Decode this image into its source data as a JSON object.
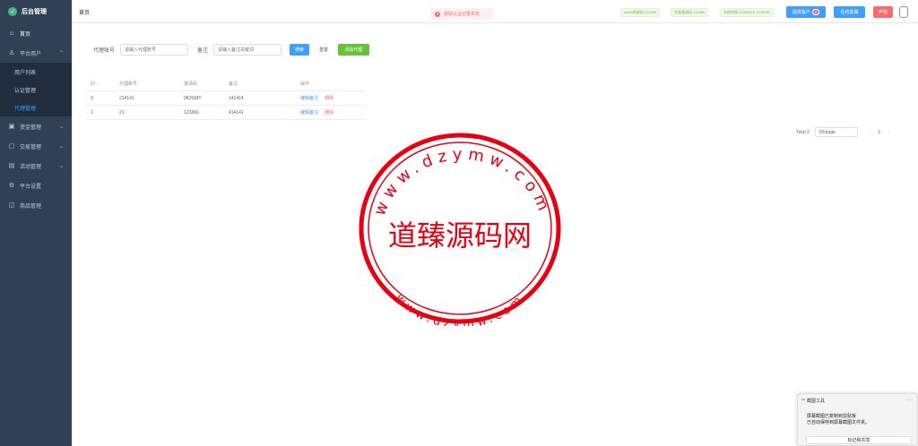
{
  "sidebar": {
    "brand": "后台管理",
    "items": [
      {
        "label": "首页",
        "icon": "home-icon"
      },
      {
        "label": "平台用户",
        "icon": "user-icon"
      },
      {
        "label": "资金管理",
        "icon": "wallet-icon"
      },
      {
        "label": "交易管理",
        "icon": "trade-icon"
      },
      {
        "label": "活动管理",
        "icon": "activity-icon"
      },
      {
        "label": "平台设置",
        "icon": "gear-icon"
      },
      {
        "label": "商品管理",
        "icon": "goods-icon"
      }
    ],
    "submenu": [
      "用户列表",
      "认证管理",
      "代理管理"
    ]
  },
  "topbar": {
    "breadcrumb": "首页",
    "alert": "获取认证记录失败",
    "tags": [
      "web3邀请码:123456",
      "交易邀请码:123456",
      "本地时间:2025/3/19 13:53:36"
    ],
    "btn_new_customer": "提现客户",
    "btn_new_customer_badge": "0",
    "btn_online": "在线客服",
    "btn_sound": "声音"
  },
  "search": {
    "agent_label": "代理账号",
    "agent_placeholder": "请输入代理账号",
    "remark_label": "备注",
    "remark_placeholder": "请输入备注关键词",
    "btn_search": "搜索",
    "btn_reset": "重置",
    "btn_add": "添加代理"
  },
  "table": {
    "headers": [
      "ID",
      "代理账号",
      "邀请码",
      "备注",
      "操作"
    ],
    "rows": [
      {
        "id": "3",
        "account": "214141",
        "code": "0K2SMY",
        "remark": "141414",
        "edit": "编辑备注",
        "delete": "删除"
      },
      {
        "id": "1",
        "account": "21",
        "code": "123456",
        "remark": "414141",
        "edit": "编辑备注",
        "delete": "删除"
      }
    ]
  },
  "pager": {
    "total": "Total 2",
    "page_size": "20/page",
    "current": "1"
  },
  "watermark": {
    "outer_top": "www.dzymw.com",
    "center": "道臻源码网",
    "outer_bottom": "www.dzymw.com"
  },
  "toast": {
    "title": "截图工具",
    "line1": "屏幕截图已复制到剪贴板",
    "line2": "已自动保存到屏幕截图文件夹。",
    "button": "标记和共享"
  },
  "colors": {
    "sidebar_bg": "#304156",
    "primary": "#409eff",
    "danger": "#f56c6c",
    "success": "#67c23a",
    "stamp": "#e60012"
  }
}
